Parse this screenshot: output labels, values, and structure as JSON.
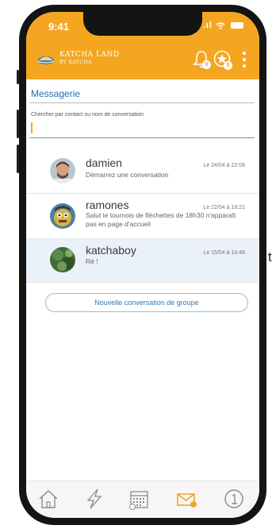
{
  "stray_char": "t",
  "status_bar": {
    "time": "9:41",
    "signal_text": ".ıl"
  },
  "header": {
    "brand_name": "KATCHA LAND",
    "brand_sub": "BY KATCHA",
    "notifications_count": "0",
    "favorites_count": "5",
    "accent_color": "#f4a621"
  },
  "page": {
    "title": "Messagerie",
    "search_placeholder": "Chercher par contact ou nom de conversation"
  },
  "conversations": [
    {
      "name": "damien",
      "date": "Le 24/04 à 22:08",
      "message": "Démarrez une conversation",
      "selected": false
    },
    {
      "name": "ramones",
      "date": "Le 22/04 à 18:21",
      "message": "Salut le tournois de fléchettes de 18h30 n'apparaît pas en page d'accueil",
      "selected": false
    },
    {
      "name": "katchaboy",
      "date": "Le 15/04 à 14:48",
      "message": "Ré !",
      "selected": true
    }
  ],
  "group_button_label": "Nouvelle conversation de groupe",
  "tabbar": {
    "items": [
      "home-icon",
      "lightning-icon",
      "calendar-icon",
      "mail-icon",
      "info-icon"
    ],
    "active": "mail-icon"
  }
}
